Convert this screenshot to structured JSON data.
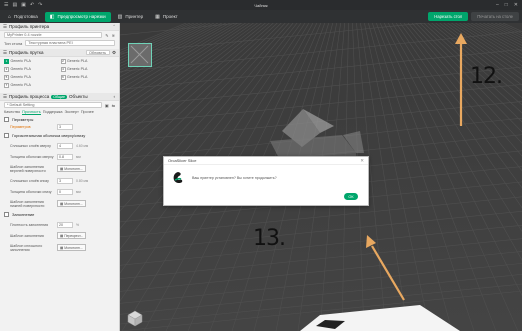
{
  "titlebar": {
    "app_title": "Чайник"
  },
  "tabs": [
    {
      "label": "Подготовка",
      "active": false
    },
    {
      "label": "Предпросмотр нарезки",
      "active": true
    },
    {
      "label": "Принтер",
      "active": false
    },
    {
      "label": "Проект",
      "active": false
    }
  ],
  "actions": {
    "slice_label": "Нарезать стол",
    "print_label": "Печатать на столе"
  },
  "printer_section": {
    "title": "Профиль принтера",
    "printer_value": "MyPrinter 0.4 nozzle",
    "plate_label": "Тип стола",
    "plate_value": "Текстурная пластина PEI"
  },
  "filament_section": {
    "title": "Профиль прутка",
    "sync_label": "Обновить",
    "items": [
      {
        "num": "1",
        "name": "Generic PLA",
        "green": true
      },
      {
        "num": "2",
        "name": "Generic PLA",
        "green": false
      },
      {
        "num": "3",
        "name": "Generic PLA",
        "green": false
      },
      {
        "num": "4",
        "name": "Generic PLA",
        "green": false
      },
      {
        "num": "5",
        "name": "Generic PLA",
        "green": false
      },
      {
        "num": "6",
        "name": "Generic PLA",
        "green": false
      },
      {
        "num": "7",
        "name": "Generic PLA",
        "green": false
      }
    ]
  },
  "process_section": {
    "title": "Профиль процесса",
    "global_label": "Общие",
    "objects_label": "Объекты",
    "preset_value": "* Default Setting",
    "subtabs": [
      "Качество",
      "Прочность",
      "Поддержка",
      "Эксперт",
      "Прочее"
    ],
    "active_subtab": 1
  },
  "params": {
    "walls_group": "Периметры",
    "walls_label": "Периметров",
    "walls_value": "3",
    "shells_group": "Горизонтальная оболочка сверху/снизу",
    "top_layers_label": "Сплошных слоёв сверху",
    "top_layers_value": "4",
    "top_layers_unit": "4.60 мм",
    "top_thickness_label": "Толщина оболочки сверху",
    "top_thickness_value": "0.8",
    "top_thickness_unit": "мм",
    "top_pattern_label": "Шаблон заполнения верхней поверхности",
    "top_pattern_value": "Монотонн...",
    "bottom_layers_label": "Сплошных слоёв снизу",
    "bottom_layers_value": "3",
    "bottom_layers_unit": "0.80 мм",
    "bottom_thickness_label": "Толщина оболочки снизу",
    "bottom_thickness_value": "0",
    "bottom_thickness_unit": "мм",
    "bottom_pattern_label": "Шаблон заполнения нижней поверхности",
    "bottom_pattern_value": "Монотонн...",
    "infill_group": "Заполнение",
    "infill_density_label": "Плотность заполнения",
    "infill_density_value": "20",
    "infill_density_unit": "%",
    "infill_pattern_label": "Шаблон заполнения",
    "infill_pattern_value": "Перекрест...",
    "solid_pattern_label": "Шаблон сплошного заполнения",
    "solid_pattern_value": "Монотонн..."
  },
  "dialog": {
    "title": "OrcaSlicer Slice",
    "message": "Ваш принтер установлен? Вы хотите продолжить?",
    "ok_label": "ОК"
  },
  "annotations": {
    "label_12": "12.",
    "label_13": "13."
  },
  "colors": {
    "accent": "#00a66c",
    "arrow": "#e8a860"
  }
}
